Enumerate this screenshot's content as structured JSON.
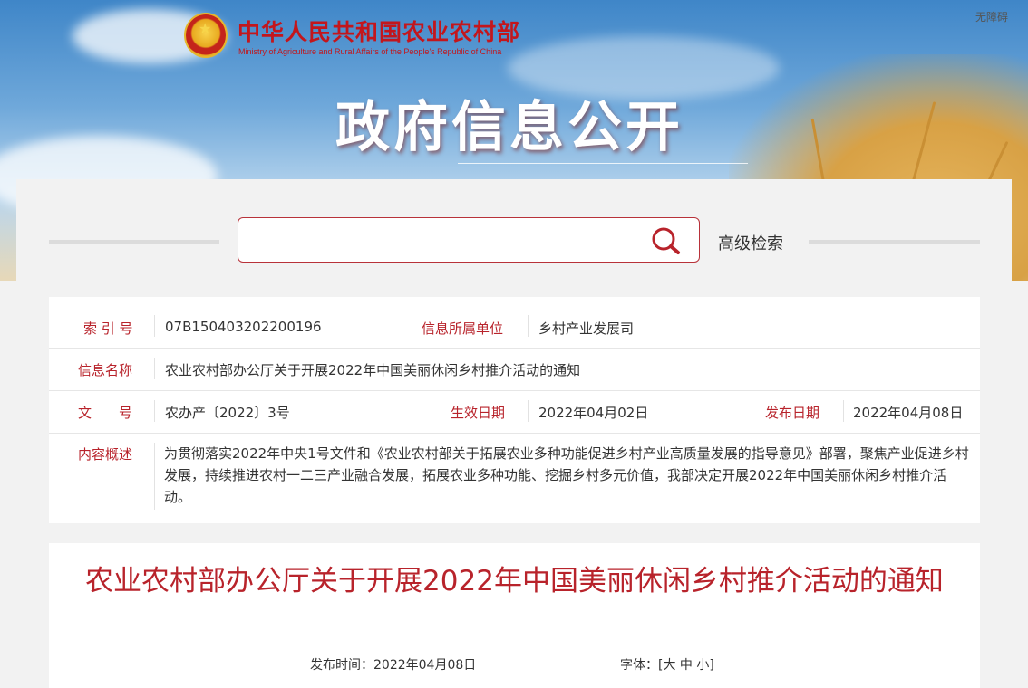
{
  "header": {
    "site_title": "中华人民共和国农业农村部",
    "site_subtitle": "Ministry of Agriculture and Rural Affairs of the People's Republic of China",
    "accessibility": "无障碍",
    "section_title": "政府信息公开"
  },
  "search": {
    "placeholder": "",
    "value": "",
    "advanced_label": "高级检索"
  },
  "meta": {
    "index_label": "索 引 号",
    "index_value": "07B150403202200196",
    "dept_label": "信息所属单位",
    "dept_value": "乡村产业发展司",
    "name_label": "信息名称",
    "name_value": "农业农村部办公厅关于开展2022年中国美丽休闲乡村推介活动的通知",
    "docno_label": "文　　号",
    "docno_value": "农办产〔2022〕3号",
    "effective_label": "生效日期",
    "effective_value": "2022年04月02日",
    "publish_label": "发布日期",
    "publish_value": "2022年04月08日",
    "summary_label": "内容概述",
    "summary_value": "为贯彻落实2022年中央1号文件和《农业农村部关于拓展农业多种功能促进乡村产业高质量发展的指导意见》部署，聚焦产业促进乡村发展，持续推进农村一二三产业融合发展，拓展农业多种功能、挖掘乡村多元价值，我部决定开展2022年中国美丽休闲乡村推介活动。"
  },
  "article": {
    "title": "农业农村部办公厅关于开展2022年中国美丽休闲乡村推介活动的通知",
    "pubtime_label": "发布时间：",
    "pubtime_value": "2022年04月08日",
    "fontsize_label": "字体：",
    "fontsize_open": "[",
    "fontsize_large": "大",
    "fontsize_medium": "中",
    "fontsize_small": "小",
    "fontsize_close": "]"
  },
  "colors": {
    "brand_red": "#c3161c",
    "label_red": "#b8232b"
  },
  "icons": {
    "emblem": "national-emblem-icon",
    "search": "search-icon"
  }
}
